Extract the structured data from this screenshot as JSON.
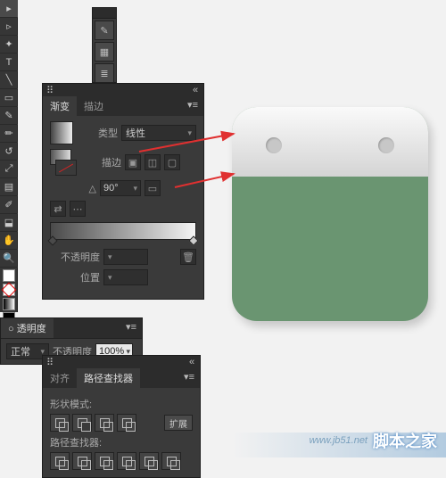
{
  "toolbar": {
    "tools": [
      "select",
      "direct",
      "wand",
      "lasso",
      "pen",
      "type",
      "line",
      "rect",
      "brush",
      "pencil",
      "rotate",
      "scale",
      "warp",
      "mesh",
      "gradient",
      "eyedrop",
      "blend",
      "symbol",
      "graph",
      "artboard",
      "slice",
      "hand",
      "zoom"
    ]
  },
  "mini_panel": {
    "buttons": [
      "brush",
      "swatch",
      "layers"
    ]
  },
  "gradient_panel": {
    "tabs": {
      "active": "渐变",
      "inactive": "描边"
    },
    "type_label": "类型",
    "type_value": "线性",
    "stroke_label": "描边",
    "angle_label": "△",
    "angle_value": "90°",
    "aspect_icon": "▭",
    "opacity_label": "不透明度",
    "position_label": "位置",
    "gradient_stops": [
      {
        "pos": 0,
        "color": "#4a4a4a"
      },
      {
        "pos": 100,
        "color": "#f5f5f5"
      }
    ]
  },
  "transparency_panel": {
    "tab": "○ 透明度",
    "blend_label": "正常",
    "opacity_label": "不透明度",
    "opacity_value": "100%"
  },
  "pathfinder_panel": {
    "tabs": {
      "align": "对齐",
      "pathfinder": "路径查找器"
    },
    "shape_mode_label": "形状模式:",
    "expand_label": "扩展",
    "pathfinder_label": "路径查找器:",
    "shape_icons": [
      "unite",
      "minus",
      "intersect",
      "exclude"
    ],
    "pf_icons": [
      "divide",
      "trim",
      "merge",
      "crop",
      "outline",
      "minus-back"
    ]
  },
  "artwork": {
    "main_color": "#6a9571",
    "top_gradient": [
      "#fafafa",
      "#d4d4d4"
    ],
    "hole_color": "#c7c7c7"
  },
  "watermark": {
    "text": "脚本之家",
    "url": "www.jb51.net"
  }
}
